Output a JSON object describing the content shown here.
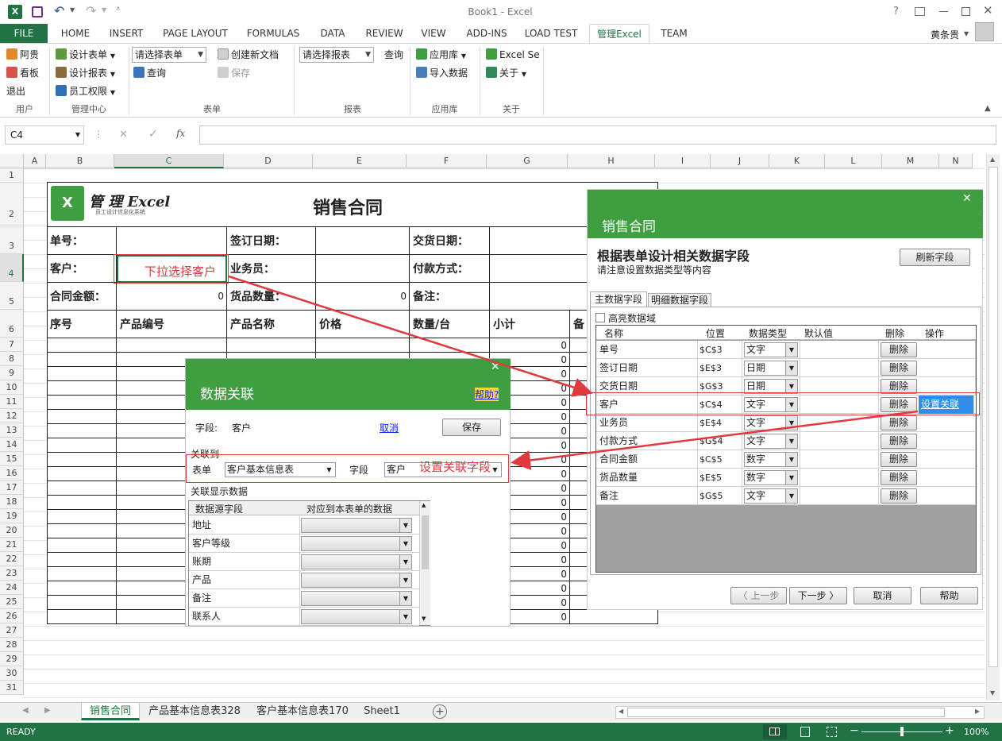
{
  "window": {
    "title": "Book1 - Excel",
    "help": "?"
  },
  "ribbon_tabs": [
    "FILE",
    "HOME",
    "INSERT",
    "PAGE LAYOUT",
    "FORMULAS",
    "DATA",
    "REVIEW",
    "VIEW",
    "ADD-INS",
    "LOAD TEST",
    "管理Excel",
    "TEAM"
  ],
  "user": {
    "name": "黄条贵"
  },
  "ribbon": {
    "user_group": {
      "label": "用户",
      "items": [
        "阿贵",
        "看板",
        "退出"
      ]
    },
    "admin_group": {
      "label": "管理中心",
      "items": [
        "设计表单",
        "设计报表",
        "员工权限"
      ]
    },
    "form_group": {
      "label": "表单",
      "select_placeholder": "请选择表单",
      "query": "查询",
      "new_doc": "创建新文档",
      "save": "保存"
    },
    "report_group": {
      "label": "报表",
      "select_placeholder": "请选择报表",
      "query": "查询"
    },
    "app_group": {
      "label": "应用库",
      "items": [
        "应用库",
        "导入数据"
      ]
    },
    "about_group": {
      "label": "关于",
      "items": [
        "Excel Se",
        "关于"
      ]
    }
  },
  "formula_bar": {
    "name_box": "C4",
    "fx": "fx",
    "cancel": "✕",
    "confirm": "✓"
  },
  "columns": [
    "A",
    "B",
    "C",
    "D",
    "E",
    "F",
    "G",
    "H",
    "I",
    "J",
    "K",
    "L",
    "M",
    "N"
  ],
  "rows": [
    "1",
    "2",
    "3",
    "4",
    "5",
    "6",
    "7",
    "8",
    "9",
    "10",
    "11",
    "12",
    "13",
    "14",
    "15",
    "16",
    "17",
    "18",
    "19",
    "20",
    "21",
    "22",
    "23",
    "24",
    "25",
    "26",
    "27",
    "28",
    "29",
    "30",
    "31"
  ],
  "form": {
    "logo_text": "管 理 Excel",
    "logo_sub": "员工设计信息化系统",
    "title": "销售合同",
    "labels": {
      "order_no": "单号：",
      "sign_date": "签订日期：",
      "delivery_date": "交货日期：",
      "customer": "客户：",
      "salesman": "业务员：",
      "payment": "付款方式：",
      "amount": "合同金额：",
      "qty": "货品数量：",
      "remark": "备注："
    },
    "amount_value": "0",
    "qty_value": "0",
    "table_headers": [
      "序号",
      "产品编号",
      "产品名称",
      "价格",
      "数量/台",
      "小计",
      "备"
    ],
    "subtotal_zero": "0"
  },
  "annotations": {
    "dropdown_customer": "下拉选择客户",
    "set_link_field": "设置关联字段"
  },
  "link_dialog": {
    "title": "数据关联",
    "help": "帮助?",
    "field_label": "字段:",
    "field_value": "客户",
    "cancel": "取消",
    "save": "保存",
    "link_to": "关联到",
    "table_label": "表单",
    "table_value": "客户基本信息表",
    "field2_label": "字段",
    "field2_value": "客户",
    "display_label": "关联显示数据",
    "grid_headers": [
      "数据源字段",
      "对应到本表单的数据"
    ],
    "grid_rows": [
      "地址",
      "客户等级",
      "账期",
      "产品",
      "备注",
      "联系人"
    ]
  },
  "design_dialog": {
    "title": "销售合同",
    "heading": "根据表单设计相关数据字段",
    "subheading": "请注意设置数据类型等内容",
    "refresh": "刷新字段",
    "tabs": [
      "主数据字段",
      "明细数据字段"
    ],
    "highlight": "高亮数据域",
    "headers": [
      "名称",
      "位置",
      "数据类型",
      "默认值",
      "删除",
      "操作"
    ],
    "rows": [
      {
        "name": "单号",
        "pos": "$C$3",
        "type": "文字",
        "del": "删除",
        "op": ""
      },
      {
        "name": "签订日期",
        "pos": "$E$3",
        "type": "日期",
        "del": "删除",
        "op": ""
      },
      {
        "name": "交货日期",
        "pos": "$G$3",
        "type": "日期",
        "del": "删除",
        "op": ""
      },
      {
        "name": "客户",
        "pos": "$C$4",
        "type": "文字",
        "del": "删除",
        "op": "设置关联"
      },
      {
        "name": "业务员",
        "pos": "$E$4",
        "type": "文字",
        "del": "删除",
        "op": ""
      },
      {
        "name": "付款方式",
        "pos": "$G$4",
        "type": "文字",
        "del": "删除",
        "op": ""
      },
      {
        "name": "合同金额",
        "pos": "$C$5",
        "type": "数字",
        "del": "删除",
        "op": ""
      },
      {
        "name": "货品数量",
        "pos": "$E$5",
        "type": "数字",
        "del": "删除",
        "op": ""
      },
      {
        "name": "备注",
        "pos": "$G$5",
        "type": "文字",
        "del": "删除",
        "op": ""
      }
    ],
    "prev": "〈 上一步",
    "next": "下一步 〉",
    "cancel": "取消",
    "help": "帮助"
  },
  "sheets": [
    "销售合同",
    "产品基本信息表328",
    "客户基本信息表170",
    "Sheet1"
  ],
  "status": {
    "ready": "READY",
    "zoom": "100%"
  },
  "colors": {
    "excel_green": "#217346",
    "dialog_green": "#3f9e3f",
    "red": "#e0393e"
  }
}
